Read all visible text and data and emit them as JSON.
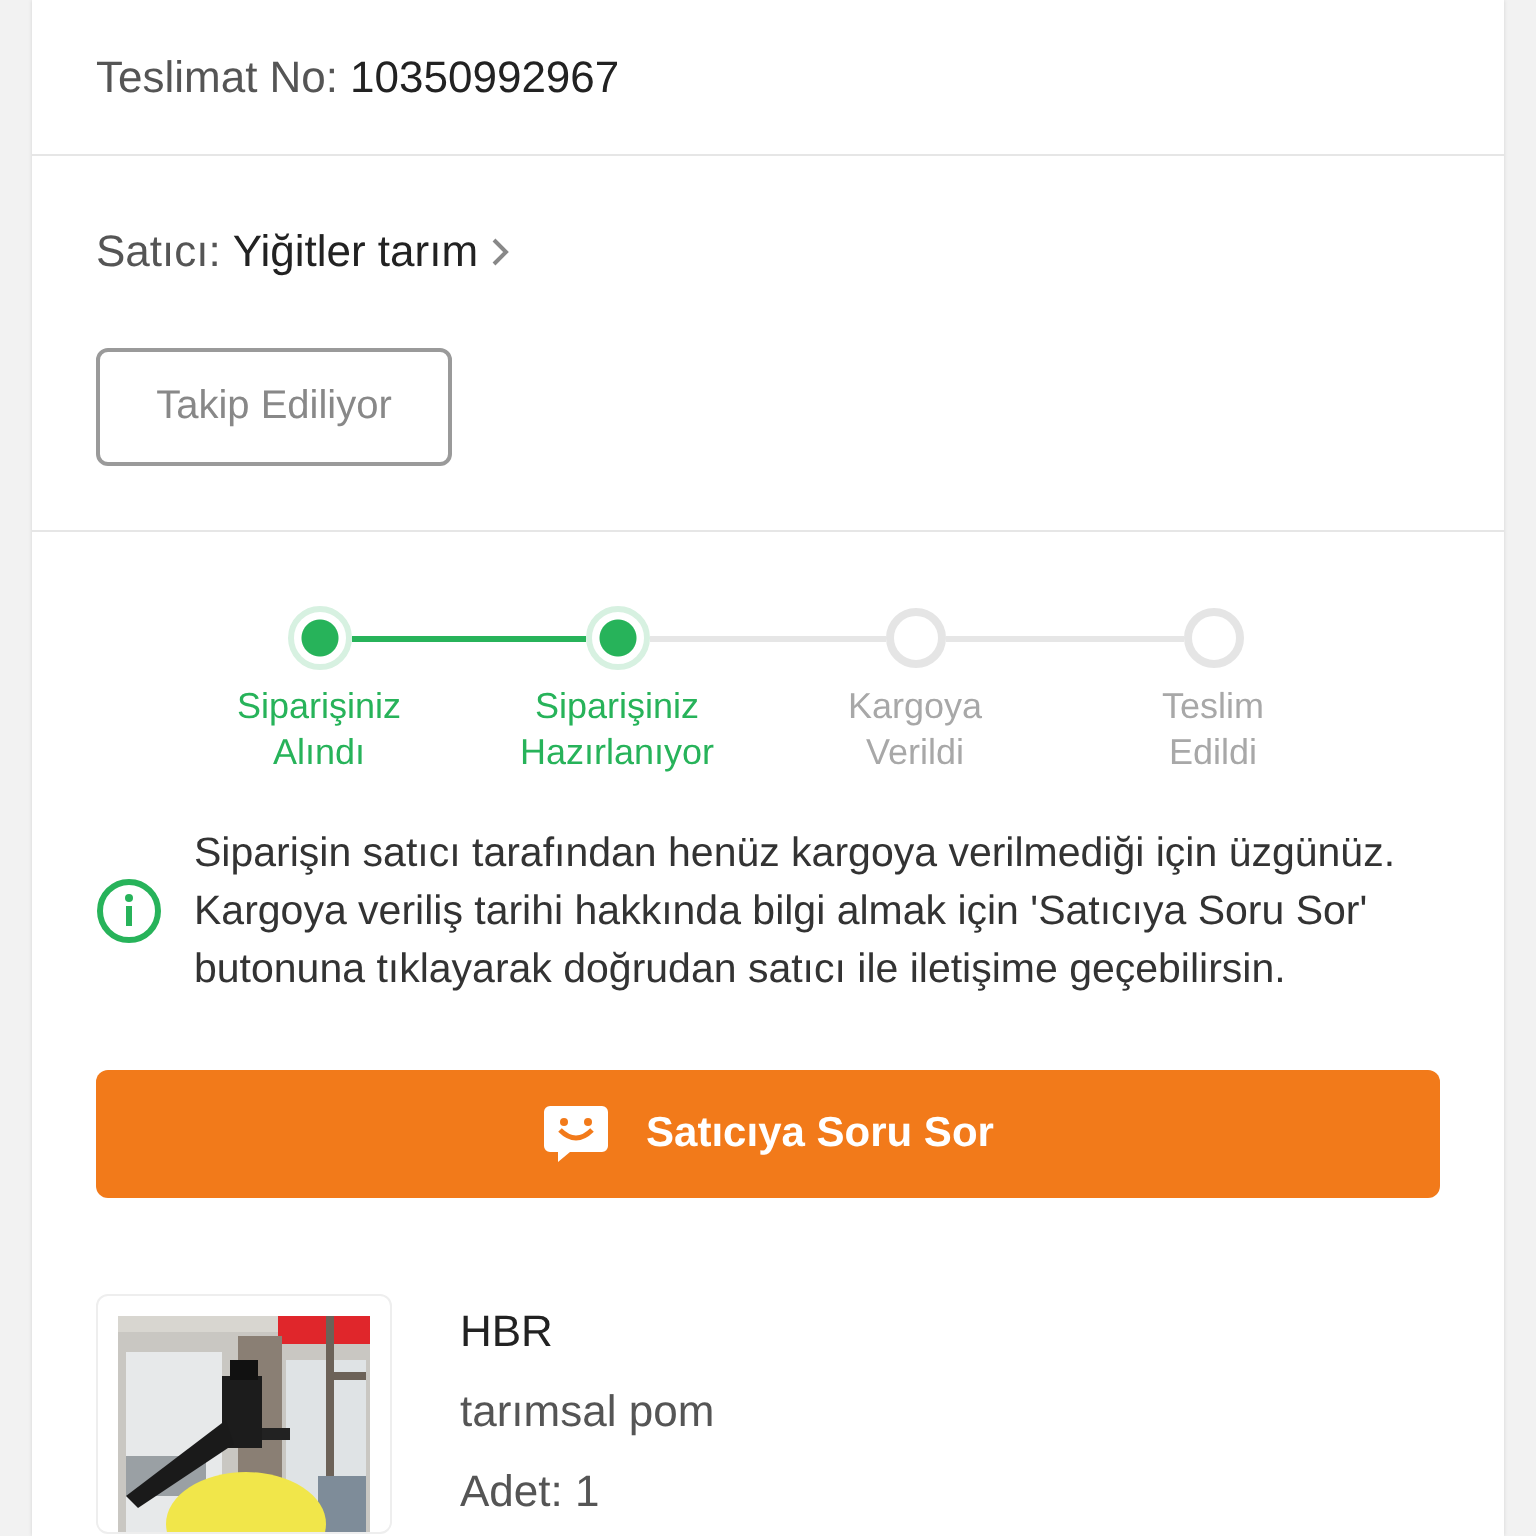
{
  "delivery": {
    "label": "Teslimat No:",
    "number": "10350992967"
  },
  "seller": {
    "label": "Satıcı:",
    "name": "Yiğitler tarım",
    "follow_button": "Takip Ediliyor"
  },
  "steps": [
    {
      "label": "Siparişiniz Alındı",
      "done": true
    },
    {
      "label": "Siparişiniz Hazırlanıyor",
      "done": true
    },
    {
      "label": "Kargoya Verildi",
      "done": false
    },
    {
      "label": "Teslim Edildi",
      "done": false
    }
  ],
  "info": {
    "text": "Siparişin satıcı tarafından henüz kargoya verilmediği için üzgünüz. Kargoya veriliş tarihi hakkında bilgi almak için 'Satıcıya Soru Sor' butonuna tıklayarak doğrudan satıcı ile iletişime geçebilirsin."
  },
  "ask_button": "Satıcıya Soru Sor",
  "product": {
    "kind": "picture",
    "brand": "HBR",
    "name": "tarımsal pom",
    "quantity": "Adet: 1"
  }
}
